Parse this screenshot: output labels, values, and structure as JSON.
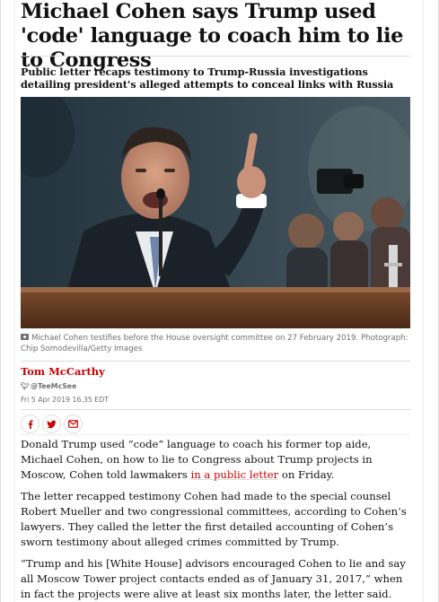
{
  "article": {
    "headline": "Michael Cohen says Trump used 'code' language to coach him to lie to Congress",
    "standfirst": "Public letter recaps testimony to Trump-Russia investigations detailing president's alleged attempts to conceal links with Russia",
    "image": {
      "caption": "Michael Cohen testifies before the House oversight committee on 27 February 2019. Photograph: Chip Somodevilla/Getty Images",
      "caption_icon": "camera-icon"
    },
    "byline": {
      "author": "Tom McCarthy",
      "twitter_handle": "@TeeMcSee",
      "twitter_icon": "twitter-bird-icon",
      "date": "Fri 5 Apr 2019 16.35 EDT"
    },
    "share": {
      "facebook_icon": "facebook-icon",
      "twitter_icon": "twitter-icon",
      "email_icon": "email-icon"
    },
    "body": {
      "p1_before": "Donald Trump used “code” language to coach his former top aide, Michael Cohen, on how to lie to Congress about Trump projects in Moscow, Cohen told lawmakers ",
      "p1_link": "in a public letter",
      "p1_after": " on Friday.",
      "p2": "The letter recapped testimony Cohen had made to the special counsel Robert Mueller and two congressional committees, according to Cohen’s lawyers. They called the letter the first detailed accounting of Cohen’s sworn testimony about alleged crimes committed by Trump.",
      "p3": "“Trump and his [White House] advisors encouraged Cohen to lie and say all Moscow Tower project contacts ended as of January 31, 2017,” when in fact the projects were alive at least six months later, the letter said."
    },
    "colors": {
      "accent": "#c70000",
      "text": "#121212",
      "muted": "#707070",
      "rule": "#dcdcdc"
    }
  }
}
